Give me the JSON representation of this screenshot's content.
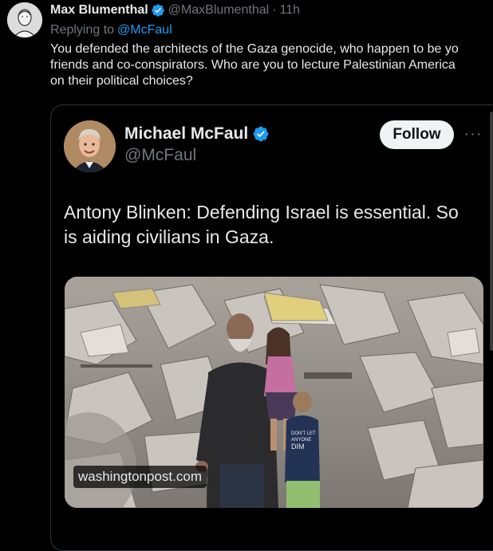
{
  "reply_tweet": {
    "author_name": "Max Blumenthal",
    "author_handle": "@MaxBlumenthal",
    "separator": "·",
    "time": "11h",
    "replying_to_label": "Replying to",
    "replying_to_handle": "@McFaul",
    "text_lines": [
      "You defended the architects of the Gaza genocide, who happen to be yo",
      "friends and co-conspirators. Who are you to lecture Palestinian America",
      "on their political choices?"
    ],
    "avatar_icon": "sketch-portrait-avatar"
  },
  "quoted_tweet": {
    "author_name": "Michael McFaul",
    "author_handle": "@McFaul",
    "follow_label": "Follow",
    "more_label": "···",
    "text_lines": [
      "Antony Blinken: Defending Israel is essential. So",
      "is aiding civilians in Gaza."
    ],
    "media_source_label": "washingtonpost.com",
    "avatar_icon": "photo-avatar"
  },
  "colors": {
    "background": "#000000",
    "text_primary": "#e7e9ea",
    "text_secondary": "#71767b",
    "accent_blue": "#1d9bf0",
    "verified_blue": "#1d9bf0",
    "follow_bg": "#eff3f4",
    "border": "#2f3336"
  }
}
